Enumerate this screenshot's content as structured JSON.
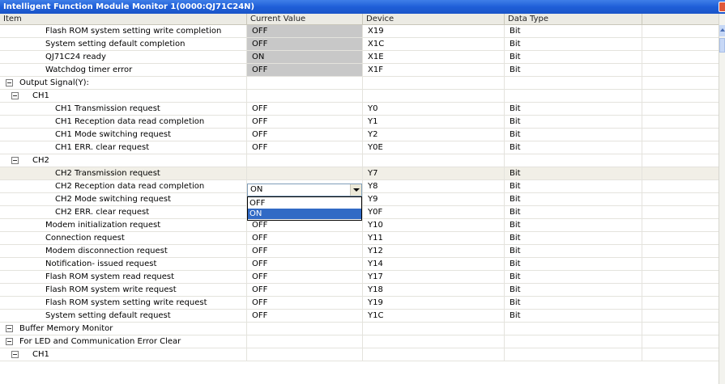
{
  "window": {
    "title": "Intelligent Function Module Monitor 1(0000:QJ71C24N)"
  },
  "columns": [
    {
      "label": "Item"
    },
    {
      "label": "Current Value"
    },
    {
      "label": "Device"
    },
    {
      "label": "Data Type"
    }
  ],
  "rows": [
    {
      "indent": 2,
      "expander": false,
      "item": "Flash ROM system setting write completion",
      "value": "OFF",
      "device": "X19",
      "type": "Bit",
      "readonly": true
    },
    {
      "indent": 2,
      "expander": false,
      "item": "System setting default completion",
      "value": "OFF",
      "device": "X1C",
      "type": "Bit",
      "readonly": true
    },
    {
      "indent": 2,
      "expander": false,
      "item": "QJ71C24 ready",
      "value": "ON",
      "device": "X1E",
      "type": "Bit",
      "readonly": true
    },
    {
      "indent": 2,
      "expander": false,
      "item": "Watchdog timer error",
      "value": "OFF",
      "device": "X1F",
      "type": "Bit",
      "readonly": true
    },
    {
      "indent": 1,
      "expander": true,
      "item": "Output Signal(Y):",
      "value": "",
      "device": "",
      "type": "",
      "readonly": false
    },
    {
      "indent": 2,
      "expander": true,
      "item": "CH1",
      "value": "",
      "device": "",
      "type": "",
      "readonly": false
    },
    {
      "indent": 3,
      "expander": false,
      "item": "CH1 Transmission request",
      "value": "OFF",
      "device": "Y0",
      "type": "Bit",
      "readonly": false
    },
    {
      "indent": 3,
      "expander": false,
      "item": "CH1 Reception data read completion",
      "value": "OFF",
      "device": "Y1",
      "type": "Bit",
      "readonly": false
    },
    {
      "indent": 3,
      "expander": false,
      "item": "CH1 Mode switching request",
      "value": "OFF",
      "device": "Y2",
      "type": "Bit",
      "readonly": false
    },
    {
      "indent": 3,
      "expander": false,
      "item": "CH1 ERR. clear request",
      "value": "OFF",
      "device": "Y0E",
      "type": "Bit",
      "readonly": false
    },
    {
      "indent": 2,
      "expander": true,
      "item": "CH2",
      "value": "",
      "device": "",
      "type": "",
      "readonly": false
    },
    {
      "indent": 3,
      "expander": false,
      "item": "CH2 Transmission request",
      "value": "",
      "device": "Y7",
      "type": "Bit",
      "readonly": false,
      "selected": true
    },
    {
      "indent": 3,
      "expander": false,
      "item": "CH2 Reception data read completion",
      "value": "",
      "device": "Y8",
      "type": "Bit",
      "readonly": false
    },
    {
      "indent": 3,
      "expander": false,
      "item": "CH2 Mode switching request",
      "value": "",
      "device": "Y9",
      "type": "Bit",
      "readonly": false
    },
    {
      "indent": 3,
      "expander": false,
      "item": "CH2 ERR. clear request",
      "value": "OFF",
      "device": "Y0F",
      "type": "Bit",
      "readonly": false
    },
    {
      "indent": 2,
      "expander": false,
      "item": "Modem initialization request",
      "value": "OFF",
      "device": "Y10",
      "type": "Bit",
      "readonly": false
    },
    {
      "indent": 2,
      "expander": false,
      "item": "Connection request",
      "value": "OFF",
      "device": "Y11",
      "type": "Bit",
      "readonly": false
    },
    {
      "indent": 2,
      "expander": false,
      "item": "Modem disconnection request",
      "value": "OFF",
      "device": "Y12",
      "type": "Bit",
      "readonly": false
    },
    {
      "indent": 2,
      "expander": false,
      "item": "Notification- issued request",
      "value": "OFF",
      "device": "Y14",
      "type": "Bit",
      "readonly": false
    },
    {
      "indent": 2,
      "expander": false,
      "item": "Flash ROM system read request",
      "value": "OFF",
      "device": "Y17",
      "type": "Bit",
      "readonly": false
    },
    {
      "indent": 2,
      "expander": false,
      "item": "Flash ROM system write request",
      "value": "OFF",
      "device": "Y18",
      "type": "Bit",
      "readonly": false
    },
    {
      "indent": 2,
      "expander": false,
      "item": "Flash ROM system setting write request",
      "value": "OFF",
      "device": "Y19",
      "type": "Bit",
      "readonly": false
    },
    {
      "indent": 2,
      "expander": false,
      "item": "System setting default request",
      "value": "OFF",
      "device": "Y1C",
      "type": "Bit",
      "readonly": false
    },
    {
      "indent": 0,
      "expander": true,
      "item": "Buffer Memory Monitor",
      "value": "",
      "device": "",
      "type": "",
      "readonly": false
    },
    {
      "indent": 1,
      "expander": true,
      "item": "For LED and Communication Error Clear",
      "value": "",
      "device": "",
      "type": "",
      "readonly": false
    },
    {
      "indent": 2,
      "expander": true,
      "item": "CH1",
      "value": "",
      "device": "",
      "type": "",
      "readonly": false
    }
  ],
  "combo": {
    "value": "ON",
    "options": [
      "OFF",
      "ON"
    ],
    "selected_option": "ON"
  },
  "colors": {
    "title_bar": "#1f5ed8",
    "readonly_cell": "#c8c8c8",
    "dropdown_selection": "#316ac5"
  },
  "icons": {
    "expander": "collapse-icon",
    "combo_arrow": "chevron-down-icon",
    "close": "close-icon",
    "scroll_up": "scroll-up-icon"
  }
}
